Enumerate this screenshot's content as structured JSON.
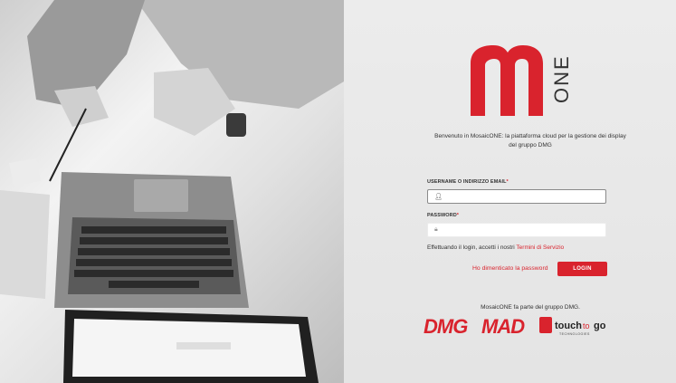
{
  "brand": {
    "logo_text": "ONE",
    "logo_alt": "MosaicONE",
    "accent_color": "#d9232d"
  },
  "welcome_text": "Benvenuto in MosaicONE: la piattaforma cloud per la gestione dei display del gruppo DMG",
  "form": {
    "username_label": "USERNAME O INDIRIZZO EMAIL",
    "username_value": "",
    "username_icon": "user-icon",
    "password_label": "PASSWORD",
    "password_value": "",
    "password_icon": "lock-icon",
    "required_mark": "*",
    "terms_prefix": "Effettuando il login, accetti i nostri",
    "terms_link": "Termini di Servizio",
    "forgot_password": "Ho dimenticato la password",
    "login_button": "LOGIN"
  },
  "footer": {
    "group_text": "MosaicONE fa parte del gruppo DMG.",
    "partners": [
      {
        "name": "DMG"
      },
      {
        "name": "MAD"
      },
      {
        "name": "touch to go",
        "sub": "TECHNOLOGIES"
      }
    ]
  }
}
